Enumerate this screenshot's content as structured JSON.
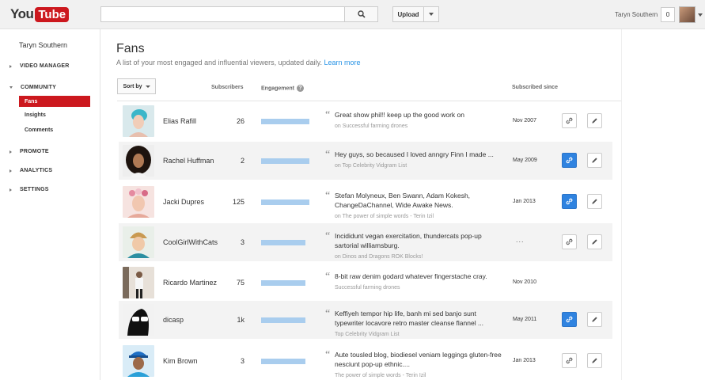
{
  "header": {
    "logo_you": "You",
    "logo_tube": "Tube",
    "search_placeholder": "",
    "upload_label": "Upload",
    "user_name": "Taryn Southern",
    "notification_count": "0"
  },
  "sidebar": {
    "user": "Taryn Southern",
    "video_manager": "VIDEO MANAGER",
    "community": "COMMUNITY",
    "fans": "Fans",
    "insights": "Insights",
    "comments": "Comments",
    "promote": "PROMOTE",
    "analytics": "ANALYTICS",
    "settings": "SETTINGS"
  },
  "main": {
    "title": "Fans",
    "description": "A list of your most engaged and influential viewers, updated daily.",
    "learn_more": "Learn more",
    "sort_label": "Sort by",
    "col_subscribers": "Subscribers",
    "col_engagement": "Engagement",
    "col_subscribed_since": "Subscribed since",
    "accent_color": "#cc181e",
    "link_color": "#2793e6",
    "engagement_bar_color": "#a9cdee"
  },
  "fans": [
    {
      "name": "Elias Rafill",
      "subscribers": "26",
      "engagement": 0.98,
      "comment": "Great show phil!! keep up the good work on",
      "on": "on Successful farming drones",
      "since": "Nov 2007",
      "linked": false,
      "thumb": "teal-hair"
    },
    {
      "name": "Rachel Huffman",
      "subscribers": "2",
      "engagement": 0.98,
      "comment": "Hey guys, so becaused I loved anngry Finn I made ...",
      "on": "on Top Celebrity Vidgram List",
      "since": "May 2009",
      "linked": true,
      "thumb": "curly-hair"
    },
    {
      "name": "Jacki Dupres",
      "subscribers": "125",
      "engagement": 0.98,
      "comment": "Stefan Molyneux, Ben Swann, Adam Kokesh, ChangeDaChannel, Wide Awake News.",
      "on": "on The power of simple words - Terin Izil",
      "since": "Jan 2013",
      "linked": true,
      "thumb": "flower-crown"
    },
    {
      "name": "CoolGirlWithCats",
      "subscribers": "3",
      "engagement": 0.9,
      "comment": "Incididunt vegan exercitation, thundercats pop-up sartorial williamsburg.",
      "on": "on Dinos and Dragons ROK Blocks!",
      "since": "...",
      "linked": false,
      "thumb": "beanie"
    },
    {
      "name": "Ricardo Martinez",
      "subscribers": "75",
      "engagement": 0.9,
      "comment": "8-bit raw denim godard whatever fingerstache cray.",
      "on": "Successful farming drones",
      "since": "Nov 2010",
      "linked": null,
      "thumb": "standing"
    },
    {
      "name": "dicasp",
      "subscribers": "1k",
      "engagement": 0.9,
      "comment": "Keffiyeh tempor hip life, banh mi sed banjo sunt typewriter locavore retro master cleanse flannel ...",
      "on": "Top Celebrity Vidgram List",
      "since": "May 2011",
      "linked": true,
      "thumb": "bw-glasses"
    },
    {
      "name": "Kim Brown",
      "subscribers": "3",
      "engagement": 0.9,
      "comment": "Aute tousled blog, biodiesel veniam leggings gluten-free nesciunt pop-up ethnic....",
      "on": "The power of simple words - Terin Izil",
      "since": "Jan 2013",
      "linked": false,
      "thumb": "blue-cap"
    }
  ]
}
